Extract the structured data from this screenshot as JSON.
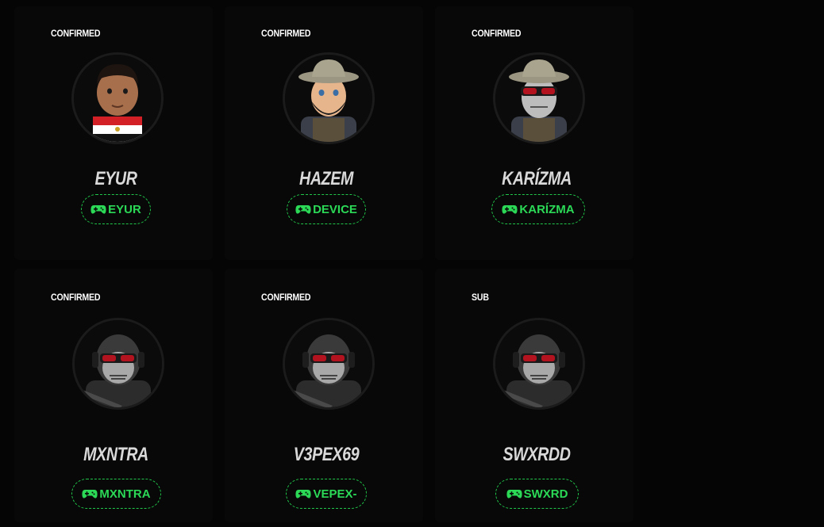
{
  "cards": [
    {
      "status": "CONFIRMED",
      "name": "EYUR",
      "tag": "EYUR",
      "avatar": "cartoon-face-avatar"
    },
    {
      "status": "CONFIRMED",
      "name": "HAZEM",
      "tag": "DEVICE",
      "avatar": "soldier-bearded-avatar"
    },
    {
      "status": "CONFIRMED",
      "name": "KARÍZMA",
      "tag": "KARÍZMA",
      "avatar": "soldier-skull-mask-avatar"
    },
    {
      "status": "CONFIRMED",
      "name": "MXNTRA",
      "tag": "MXNTRA",
      "avatar": "ghost-skull-avatar"
    },
    {
      "status": "CONFIRMED",
      "name": "V3PEX69",
      "tag": "VEPEX-",
      "avatar": "ghost-skull-avatar"
    },
    {
      "status": "SUB",
      "name": "SWXRDD",
      "tag": "SWXRD",
      "avatar": "ghost-skull-avatar"
    }
  ],
  "colors": {
    "accent": "#2bd957",
    "background": "#050505",
    "card": "#080808"
  },
  "icons": {
    "tag_icon": "gamepad-icon"
  }
}
